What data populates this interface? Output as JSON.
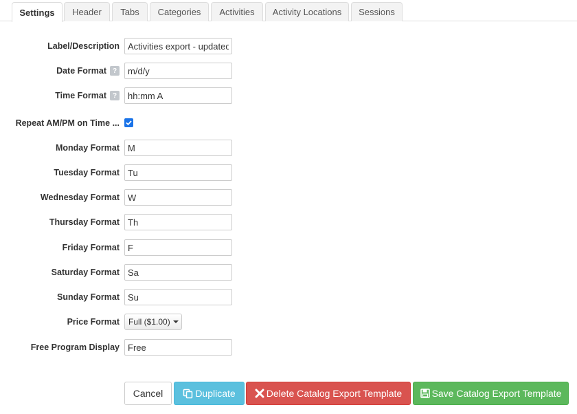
{
  "tabs": [
    {
      "label": "Settings",
      "active": true
    },
    {
      "label": "Header"
    },
    {
      "label": "Tabs"
    },
    {
      "label": "Categories"
    },
    {
      "label": "Activities"
    },
    {
      "label": "Activity Locations"
    },
    {
      "label": "Sessions"
    }
  ],
  "form": {
    "label_description": {
      "label": "Label/Description",
      "value": "Activities export - updated"
    },
    "date_format": {
      "label": "Date Format",
      "help": "?",
      "value": "m/d/y"
    },
    "time_format": {
      "label": "Time Format",
      "help": "?",
      "value": "hh:mm A"
    },
    "repeat_ampm": {
      "label": "Repeat AM/PM on Time ...",
      "checked": true
    },
    "monday": {
      "label": "Monday Format",
      "value": "M"
    },
    "tuesday": {
      "label": "Tuesday Format",
      "value": "Tu"
    },
    "wednesday": {
      "label": "Wednesday Format",
      "value": "W"
    },
    "thursday": {
      "label": "Thursday Format",
      "value": "Th"
    },
    "friday": {
      "label": "Friday Format",
      "value": "F"
    },
    "saturday": {
      "label": "Saturday Format",
      "value": "Sa"
    },
    "sunday": {
      "label": "Sunday Format",
      "value": "Su"
    },
    "price_format": {
      "label": "Price Format",
      "selected": "Full ($1.00)"
    },
    "free_program": {
      "label": "Free Program Display",
      "value": "Free"
    }
  },
  "buttons": {
    "cancel": "Cancel",
    "duplicate": "Duplicate",
    "delete": "Delete Catalog Export Template",
    "save": "Save Catalog Export Template"
  },
  "colors": {
    "duplicate": "#5bc0de",
    "delete": "#d9534f",
    "save": "#5cb85c",
    "checkbox": "#1a73e8"
  },
  "icons": {
    "duplicate": "copy-icon",
    "delete": "x-icon",
    "save": "floppy-disk-icon",
    "help": "question-icon",
    "dropdown": "caret-down-icon"
  }
}
